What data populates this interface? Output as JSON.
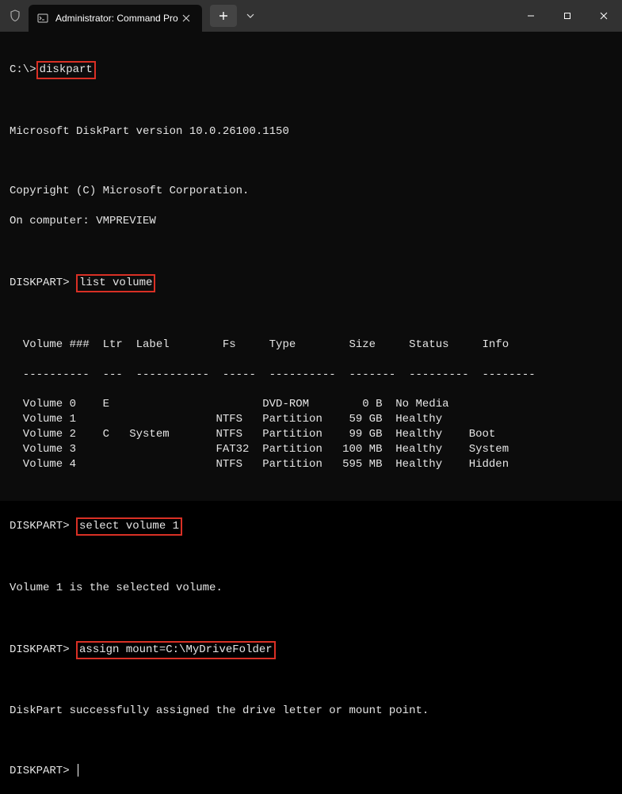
{
  "titlebar": {
    "tab_title": "Administrator: Command Pro"
  },
  "terminal": {
    "prompt1_prefix": "C:\\>",
    "cmd1": "diskpart",
    "version_line": "Microsoft DiskPart version 10.0.26100.1150",
    "copyright_line": "Copyright (C) Microsoft Corporation.",
    "computer_line": "On computer: VMPREVIEW",
    "dp_prompt": "DISKPART> ",
    "cmd2": "list volume",
    "table_header": "  Volume ###  Ltr  Label        Fs     Type        Size     Status     Info",
    "table_divider": "  ----------  ---  -----------  -----  ----------  -------  ---------  --------",
    "cmd3": "select volume 1",
    "selected_line": "Volume 1 is the selected volume.",
    "cmd4": "assign mount=C:\\MyDriveFolder",
    "success_line": "DiskPart successfully assigned the drive letter or mount point."
  },
  "volume_table": [
    {
      "idx": "0",
      "ltr": "E",
      "label": "",
      "fs": "",
      "type": "DVD-ROM",
      "size": "0 B",
      "status": "No Media",
      "info": ""
    },
    {
      "idx": "1",
      "ltr": "",
      "label": "",
      "fs": "NTFS",
      "type": "Partition",
      "size": "59 GB",
      "status": "Healthy",
      "info": ""
    },
    {
      "idx": "2",
      "ltr": "C",
      "label": "System",
      "fs": "NTFS",
      "type": "Partition",
      "size": "99 GB",
      "status": "Healthy",
      "info": "Boot"
    },
    {
      "idx": "3",
      "ltr": "",
      "label": "",
      "fs": "FAT32",
      "type": "Partition",
      "size": "100 MB",
      "status": "Healthy",
      "info": "System"
    },
    {
      "idx": "4",
      "ltr": "",
      "label": "",
      "fs": "NTFS",
      "type": "Partition",
      "size": "595 MB",
      "status": "Healthy",
      "info": "Hidden"
    }
  ]
}
